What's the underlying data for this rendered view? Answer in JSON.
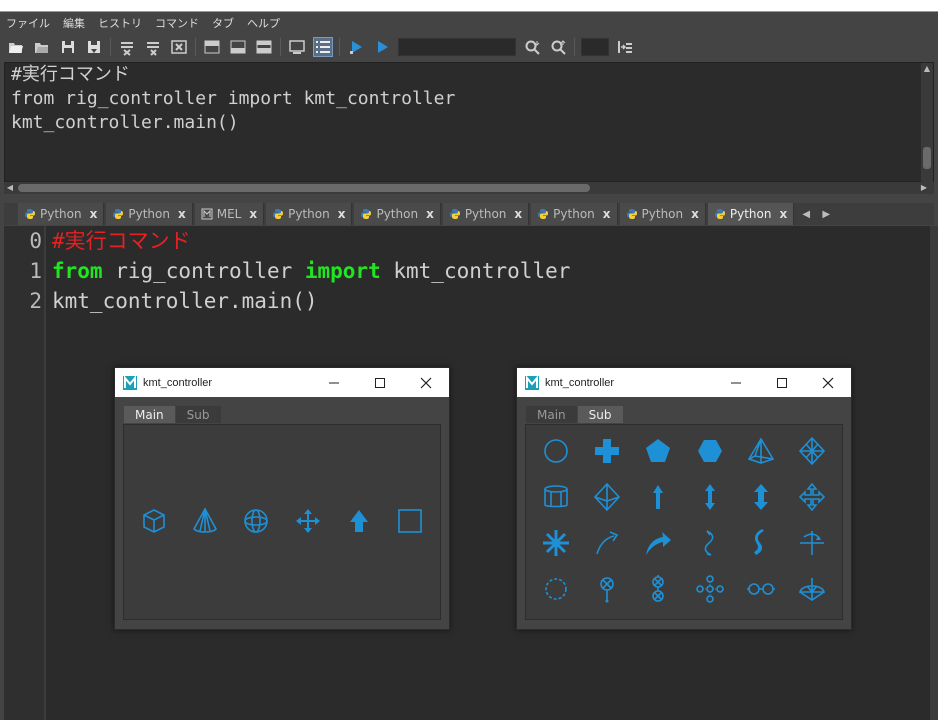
{
  "menu": [
    "ファイル",
    "編集",
    "ヒストリ",
    "コマンド",
    "タブ",
    "ヘルプ"
  ],
  "history": {
    "lines": [
      "#実行コマンド",
      "from rig_controller import kmt_controller",
      "kmt_controller.main()"
    ]
  },
  "tabs": [
    {
      "label": "Python",
      "icon": "python-icon",
      "close": "x"
    },
    {
      "label": "Python",
      "icon": "python-icon",
      "close": "x"
    },
    {
      "label": "MEL",
      "icon": "mel-icon",
      "close": "x"
    },
    {
      "label": "Python",
      "icon": "python-icon",
      "close": "x"
    },
    {
      "label": "Python",
      "icon": "python-icon",
      "close": "x"
    },
    {
      "label": "Python",
      "icon": "python-icon",
      "close": "x"
    },
    {
      "label": "Python",
      "icon": "python-icon",
      "close": "x"
    },
    {
      "label": "Python",
      "icon": "python-icon",
      "close": "x"
    },
    {
      "label": "Python",
      "icon": "python-icon",
      "close": "x",
      "active": true
    }
  ],
  "editor": {
    "line_numbers": [
      "0",
      "1",
      "2"
    ],
    "line0": "#実行コマンド",
    "line1_kw1": "from",
    "line1_mid": " rig_controller ",
    "line1_kw2": "import",
    "line1_end": " kmt_controller",
    "line2": "kmt_controller.main()"
  },
  "window_main": {
    "title": "kmt_controller",
    "tab_main": "Main",
    "tab_sub": "Sub",
    "active_tab": "Main",
    "icons": [
      "cube-icon",
      "cone-icon",
      "sphere-icon",
      "move-arrows-icon",
      "arrow-up-icon",
      "square-icon"
    ]
  },
  "window_sub": {
    "title": "kmt_controller",
    "tab_main": "Main",
    "tab_sub": "Sub",
    "active_tab": "Sub",
    "icons": [
      "circle-icon",
      "cross-icon",
      "pentagon-icon",
      "hexagon-icon",
      "pyramid-icon",
      "diamond-icon",
      "cylinder-icon",
      "octahedron-icon",
      "thin-arrow-up-icon",
      "double-arrow-icon",
      "bold-double-arrow-icon",
      "four-way-arrow-icon",
      "star-burst-icon",
      "curved-arrow-icon",
      "bold-curved-arrow-icon",
      "twist-arrow-icon",
      "bold-twist-arrow-icon",
      "rotate-axis-icon",
      "gear-circle-icon",
      "pin-icon",
      "double-pin-icon",
      "dotted-cross-icon",
      "glasses-icon",
      "umbrella-icon"
    ]
  },
  "colors": {
    "accent": "#1e90d6",
    "comment": "#e52222",
    "keyword": "#22e522"
  }
}
